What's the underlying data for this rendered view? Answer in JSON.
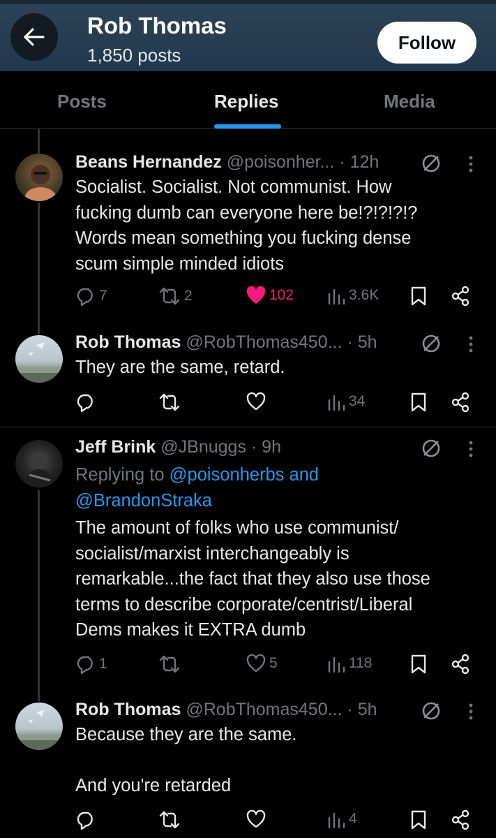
{
  "header": {
    "title": "Rob Thomas",
    "subtitle": "1,850 posts",
    "follow_label": "Follow"
  },
  "tabs": [
    {
      "label": "Posts",
      "active": false
    },
    {
      "label": "Replies",
      "active": true
    },
    {
      "label": "Media",
      "active": false
    }
  ],
  "colors": {
    "accent": "#1d9bf0",
    "like": "#f91880",
    "header_bg": "#2a3f53"
  },
  "tweets": [
    {
      "name": "Beans Hernandez",
      "handle": "@poisonher...",
      "time": "· 12h",
      "text": "Socialist. Socialist. Not communist. How\nfucking dumb can everyone here be!?!?!?!?\nWords mean something you fucking dense\nscum simple minded idiots",
      "replies": "7",
      "reposts": "2",
      "likes": "102",
      "views": "3.6K",
      "liked": true
    },
    {
      "name": "Rob Thomas",
      "handle": "@RobThomas450...",
      "time": "· 5h",
      "text": "They are the same, retard.",
      "replies": "",
      "reposts": "",
      "likes": "",
      "views": "34",
      "liked": false
    },
    {
      "name": "Jeff Brink",
      "handle": "@JBnuggs",
      "time": "· 9h",
      "replying_prefix": "Replying to ",
      "replying_to_1": "@poisonherbs and",
      "replying_to_2": "@BrandonStraka",
      "text": "The amount of folks who use communist/\nsocialist/marxist interchangeably is\nremarkable...the fact that they also use those\nterms to describe corporate/centrist/Liberal\nDems makes it EXTRA dumb",
      "replies": "1",
      "reposts": "",
      "likes": "5",
      "views": "118",
      "liked": false
    },
    {
      "name": "Rob Thomas",
      "handle": "@RobThomas450...",
      "time": "· 5h",
      "text": "Because they are the same.\n\nAnd you're retarded",
      "replies": "",
      "reposts": "",
      "likes": "",
      "views": "4",
      "liked": false
    }
  ]
}
